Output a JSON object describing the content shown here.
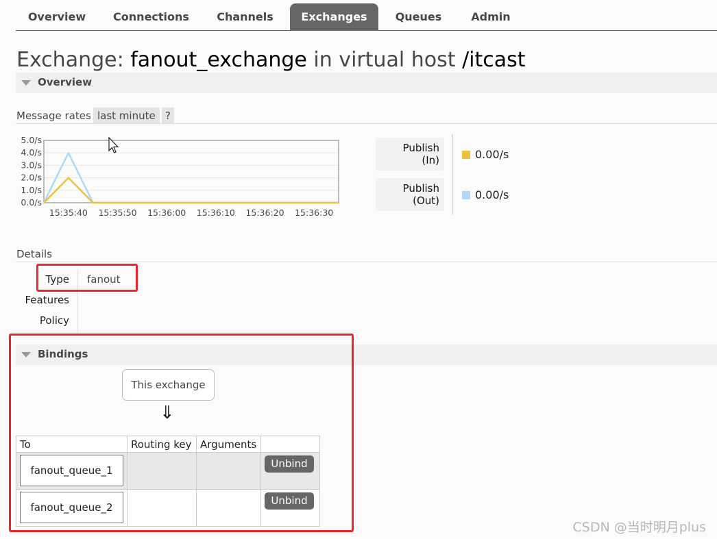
{
  "nav": {
    "tabs": [
      "Overview",
      "Connections",
      "Channels",
      "Exchanges",
      "Queues",
      "Admin"
    ],
    "active": "Exchanges"
  },
  "title": {
    "prefix": "Exchange: ",
    "name": "fanout_exchange",
    "middle": " in virtual host ",
    "vhost": "/itcast"
  },
  "overview": {
    "label": "Overview",
    "message_rates_label": "Message rates",
    "range": "last minute",
    "help": "?",
    "legend": [
      {
        "label_line1": "Publish",
        "label_line2": "(In)",
        "value": "0.00/s",
        "color": "#edc240"
      },
      {
        "label_line1": "Publish",
        "label_line2": "(Out)",
        "value": "0.00/s",
        "color": "#afd8f8"
      }
    ]
  },
  "chart_data": {
    "type": "line",
    "x": [
      "15:35:40",
      "15:35:50",
      "15:36:00",
      "15:36:10",
      "15:36:20",
      "15:36:30"
    ],
    "ylim": [
      0,
      5
    ],
    "yticks": [
      "5.0/s",
      "4.0/s",
      "3.0/s",
      "2.0/s",
      "1.0/s",
      "0.0/s"
    ],
    "series": [
      {
        "name": "Publish (In)",
        "color": "#edc240",
        "points": [
          [
            -5,
            0
          ],
          [
            0,
            2
          ],
          [
            5,
            0
          ],
          [
            55,
            0
          ]
        ]
      },
      {
        "name": "Publish (Out)",
        "color": "#afd8f8",
        "points": [
          [
            -5,
            0
          ],
          [
            0,
            4
          ],
          [
            5,
            0
          ],
          [
            55,
            0
          ]
        ]
      }
    ],
    "grid": true
  },
  "details": {
    "label": "Details",
    "type_label": "Type",
    "type_value": "fanout",
    "features_label": "Features",
    "policy_label": "Policy"
  },
  "bindings": {
    "label": "Bindings",
    "this_exchange": "This exchange",
    "arrow": "⇓",
    "headers": [
      "To",
      "Routing key",
      "Arguments",
      ""
    ],
    "rows": [
      {
        "to": "fanout_queue_1",
        "action": "Unbind"
      },
      {
        "to": "fanout_queue_2",
        "action": "Unbind"
      }
    ]
  },
  "watermark": "CSDN @当时明月plus"
}
